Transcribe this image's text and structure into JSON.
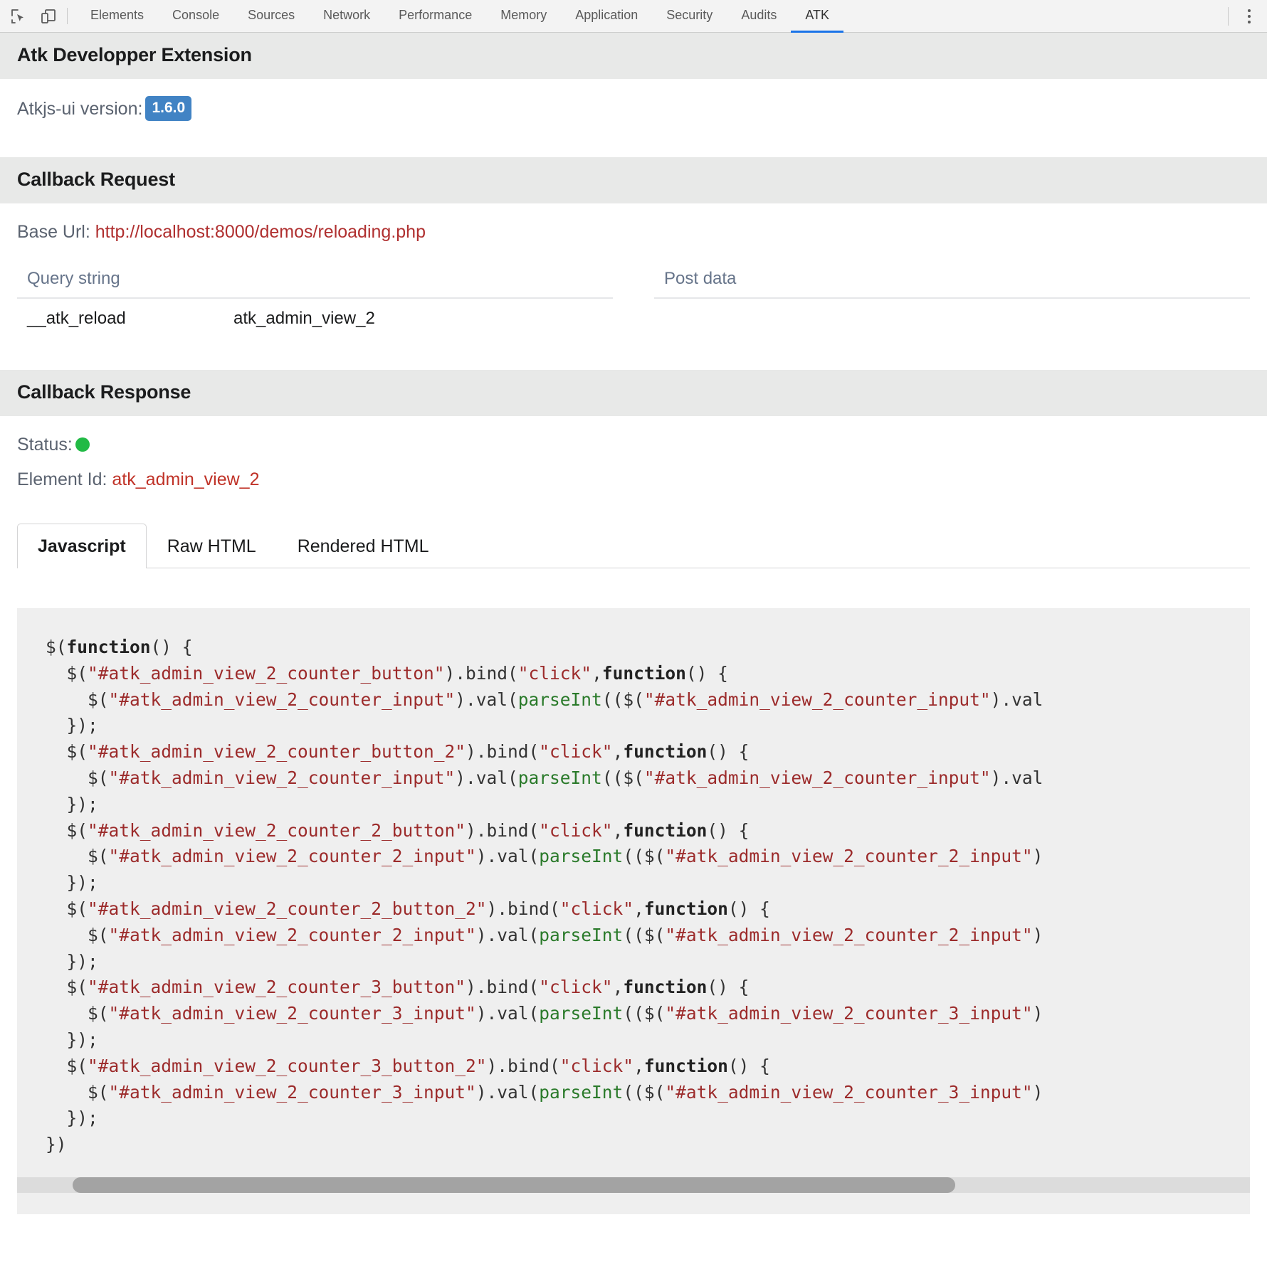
{
  "devtools": {
    "icons": [
      {
        "name": "inspect-element-icon"
      },
      {
        "name": "device-toolbar-icon"
      }
    ],
    "tabs": [
      {
        "label": "Elements",
        "active": false
      },
      {
        "label": "Console",
        "active": false
      },
      {
        "label": "Sources",
        "active": false
      },
      {
        "label": "Network",
        "active": false
      },
      {
        "label": "Performance",
        "active": false
      },
      {
        "label": "Memory",
        "active": false
      },
      {
        "label": "Application",
        "active": false
      },
      {
        "label": "Security",
        "active": false
      },
      {
        "label": "Audits",
        "active": false
      },
      {
        "label": "ATK",
        "active": true
      }
    ],
    "menu_icon": "more-vertical-icon",
    "active_tab_color": "#1a73e8"
  },
  "extension": {
    "title": "Atk Developper Extension",
    "version_label": "Atkjs-ui version:",
    "version_value": "1.6.0",
    "version_badge_color": "#4183c4"
  },
  "callback_request": {
    "title": "Callback Request",
    "base_url_label": "Base Url:",
    "base_url_value": "http://localhost:8000/demos/reloading.php",
    "base_url_color": "#b03030",
    "query_string": {
      "header": "Query string",
      "rows": [
        {
          "key": "__atk_reload",
          "value": "atk_admin_view_2"
        }
      ]
    },
    "post_data": {
      "header": "Post data",
      "rows": []
    }
  },
  "callback_response": {
    "title": "Callback Response",
    "status_label": "Status:",
    "status_color": "#21ba45",
    "element_id_label": "Element Id:",
    "element_id_value": "atk_admin_view_2",
    "element_id_color": "#c03328",
    "tabs": [
      {
        "label": "Javascript",
        "active": true
      },
      {
        "label": "Raw HTML",
        "active": false
      },
      {
        "label": "Rendered HTML",
        "active": false
      }
    ],
    "code": "$(function() {\n  $(\"#atk_admin_view_2_counter_button\").bind(\"click\",function() {\n    $(\"#atk_admin_view_2_counter_input\").val(parseInt(($(\"#atk_admin_view_2_counter_input\").val\n  });\n  $(\"#atk_admin_view_2_counter_button_2\").bind(\"click\",function() {\n    $(\"#atk_admin_view_2_counter_input\").val(parseInt(($(\"#atk_admin_view_2_counter_input\").val\n  });\n  $(\"#atk_admin_view_2_counter_2_button\").bind(\"click\",function() {\n    $(\"#atk_admin_view_2_counter_2_input\").val(parseInt(($(\"#atk_admin_view_2_counter_2_input\")\n  });\n  $(\"#atk_admin_view_2_counter_2_button_2\").bind(\"click\",function() {\n    $(\"#atk_admin_view_2_counter_2_input\").val(parseInt(($(\"#atk_admin_view_2_counter_2_input\")\n  });\n  $(\"#atk_admin_view_2_counter_3_button\").bind(\"click\",function() {\n    $(\"#atk_admin_view_2_counter_3_input\").val(parseInt(($(\"#atk_admin_view_2_counter_3_input\")\n  });\n  $(\"#atk_admin_view_2_counter_3_button_2\").bind(\"click\",function() {\n    $(\"#atk_admin_view_2_counter_3_input\").val(parseInt(($(\"#atk_admin_view_2_counter_3_input\")\n  });\n})"
  }
}
